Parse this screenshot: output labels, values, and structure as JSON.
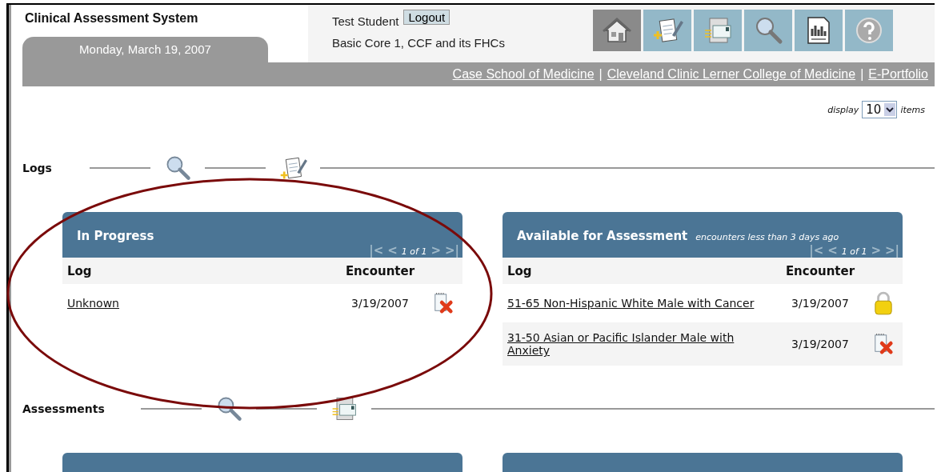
{
  "header": {
    "title": "Clinical Assessment System",
    "date": "Monday, March 19, 2007",
    "user": "Test Student",
    "logout": "Logout",
    "course": "Basic Core 1, CCF and its FHCs"
  },
  "toolbar": [
    {
      "kind": "home",
      "selected": true
    },
    {
      "kind": "new-log",
      "selected": false
    },
    {
      "kind": "assessment",
      "selected": false
    },
    {
      "kind": "search",
      "selected": false
    },
    {
      "kind": "report",
      "selected": false
    },
    {
      "kind": "help",
      "selected": false
    }
  ],
  "links": [
    "Case School of Medicine",
    "Cleveland Clinic Lerner College of Medicine",
    "E-Portfolio"
  ],
  "link_separator": "|",
  "display": {
    "label": "display",
    "value": "10",
    "suffix": "items"
  },
  "sections": [
    {
      "title": "Logs",
      "icons": [
        {
          "kind": "search"
        },
        {
          "kind": "new-log"
        }
      ],
      "panels": [
        {
          "kind": "table",
          "title": "In Progress",
          "pager": {
            "first": "|<",
            "prev": "<",
            "page": "1 of 1",
            "next": ">",
            "last": ">|"
          },
          "columns": [
            "Log",
            "Encounter"
          ],
          "rows": [
            {
              "log": "Unknown",
              "encounter": "3/19/2007",
              "kind": "delete"
            }
          ]
        },
        {
          "kind": "table",
          "title": "Available for Assessment",
          "subtitle": "encounters less than 3 days ago",
          "pager": {
            "first": "|<",
            "prev": "<",
            "page": "1 of 1",
            "next": ">",
            "last": ">|"
          },
          "columns": [
            "Log",
            "Encounter"
          ],
          "rows": [
            {
              "log": "51-65 Non-Hispanic White Male with Cancer",
              "encounter": "3/19/2007",
              "kind": "locked"
            },
            {
              "log": "31-50 Asian or Pacific Islander Male with Anxiety",
              "encounter": "3/19/2007",
              "kind": "delete"
            }
          ]
        }
      ]
    },
    {
      "title": "Assessments",
      "icons": [
        {
          "kind": "search"
        },
        {
          "kind": "assessment"
        }
      ],
      "panels": [
        {
          "kind": "cut-off"
        },
        {
          "kind": "cut-off"
        }
      ]
    }
  ],
  "annotation": {
    "kind": "ellipse",
    "color": "#7a0a0a"
  }
}
